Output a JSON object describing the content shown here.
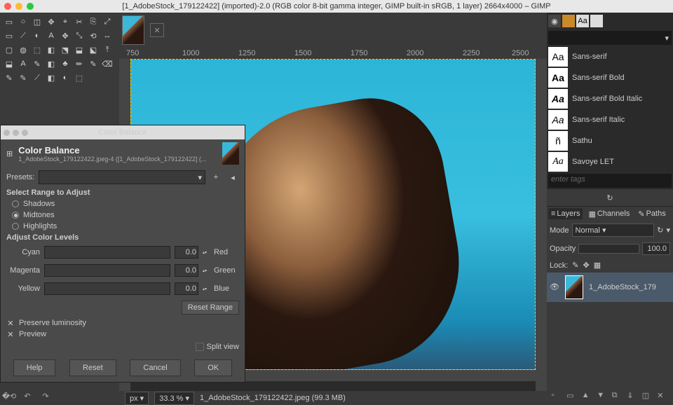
{
  "window": {
    "title": "[1_AdobeStock_179122422] (imported)-2.0 (RGB color 8-bit gamma integer, GIMP built-in sRGB, 1 layer) 2664x4000 – GIMP"
  },
  "ruler": {
    "t750": "750",
    "t1000": "1000",
    "t1250": "1250",
    "t1500": "1500",
    "t1750": "1750",
    "t2000": "2000",
    "t2250": "2250",
    "t2500": "2500"
  },
  "status": {
    "unit": "px",
    "zoom": "33.3 %",
    "file": "1_AdobeStock_179122422.jpeg (99.3 MB)"
  },
  "fonts": {
    "items": [
      {
        "glyph": "Aa",
        "name": "Sans-serif",
        "cls": ""
      },
      {
        "glyph": "Aa",
        "name": "Sans-serif Bold",
        "cls": "bold"
      },
      {
        "glyph": "Aa",
        "name": "Sans-serif Bold Italic",
        "cls": "bold italic"
      },
      {
        "glyph": "Aa",
        "name": "Sans-serif Italic",
        "cls": "italic"
      },
      {
        "glyph": "ñ",
        "name": "Sathu",
        "cls": ""
      },
      {
        "glyph": "Aa",
        "name": "Savoye LET",
        "cls": "script"
      }
    ],
    "tags": "enter tags"
  },
  "layers": {
    "tab_layers": "Layers",
    "tab_channels": "Channels",
    "tab_paths": "Paths",
    "mode_label": "Mode",
    "mode_value": "Normal",
    "opacity_label": "Opacity",
    "opacity_value": "100.0",
    "lock_label": "Lock:",
    "layer_name": "1_AdobeStock_179"
  },
  "dialog": {
    "title": "Color Balance",
    "heading": "Color Balance",
    "sub": "1_AdobeStock_179122422.jpeg-4 ([1_AdobeStock_179122422] (...",
    "presets_label": "Presets:",
    "range_label": "Select Range to Adjust",
    "r_shadows": "Shadows",
    "r_midtones": "Midtones",
    "r_highlights": "Highlights",
    "levels_label": "Adjust Color Levels",
    "cyan": "Cyan",
    "red": "Red",
    "magenta": "Magenta",
    "green": "Green",
    "yellow": "Yellow",
    "blue": "Blue",
    "val": "0.0",
    "reset_range": "Reset Range",
    "preserve": "Preserve luminosity",
    "preview": "Preview",
    "split": "Split view",
    "help": "Help",
    "reset": "Reset",
    "cancel": "Cancel",
    "ok": "OK"
  }
}
